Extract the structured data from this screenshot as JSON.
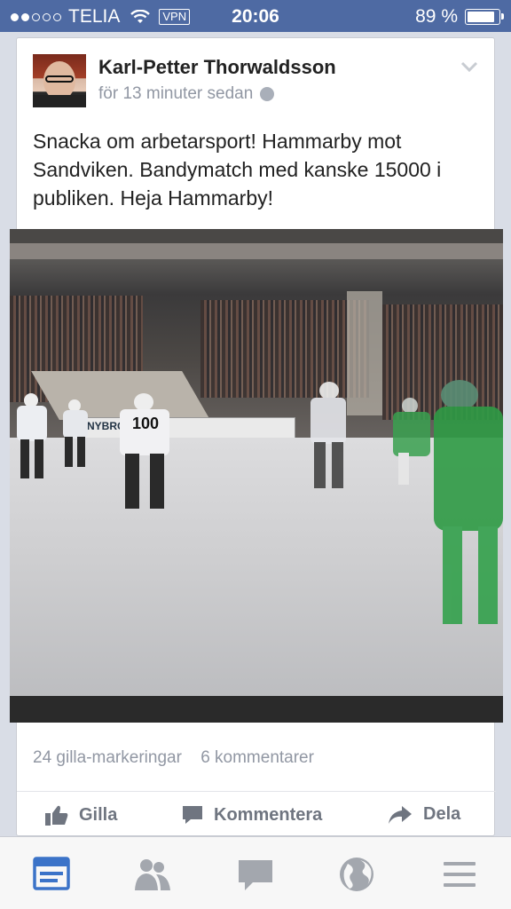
{
  "status_bar": {
    "carrier": "TELIA",
    "vpn": "VPN",
    "time": "20:06",
    "battery": "89 %"
  },
  "post": {
    "author": "Karl-Petter Thorwaldsson",
    "timestamp": "för 13 minuter sedan",
    "text": "Snacka om arbetarsport! Hammarby mot Sandviken. Bandymatch med kanske 15000 i publiken. Heja Hammarby!",
    "likes": "24 gilla-markeringar",
    "comments": "6 kommentarer",
    "jersey_number": "100",
    "board_text": "NYBRO EXPRE"
  },
  "actions": {
    "like": "Gilla",
    "comment": "Kommentera",
    "share": "Dela"
  },
  "colors": {
    "status_bar": "#4e6aa3",
    "active_tab": "#3b73c8",
    "inactive_tab": "#a3a7ae",
    "hammarby_green": "#2f9b45"
  },
  "tabs": [
    "news-feed-icon",
    "friends-icon",
    "messages-icon",
    "notifications-globe-icon",
    "menu-icon"
  ]
}
